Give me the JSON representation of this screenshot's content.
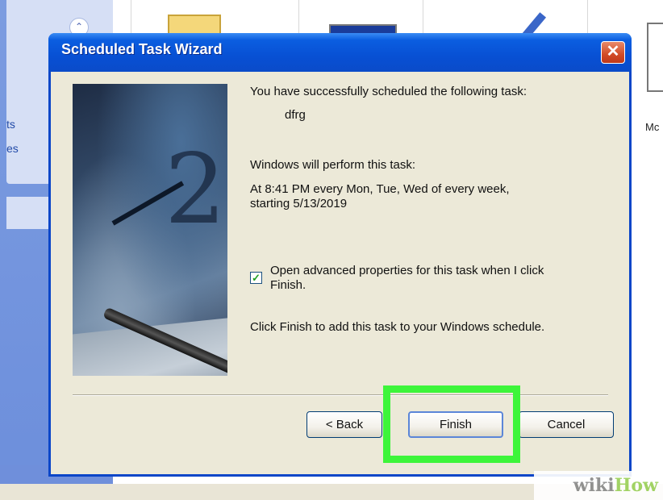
{
  "dialog": {
    "title": "Scheduled Task Wizard",
    "close_glyph": "✕",
    "success_text": "You have successfully scheduled the following task:",
    "task_name": "dfrg",
    "perform_label": "Windows will perform this task:",
    "schedule_line1": "At 8:41 PM every Mon, Tue, Wed of every week,",
    "schedule_line2": "starting 5/13/2019",
    "checkbox_line1": "Open advanced properties for this task when I click",
    "checkbox_line2": "Finish.",
    "checkbox_checked": true,
    "checkbox_mark": "✓",
    "finish_hint": "Click Finish to add this task to your Windows schedule.",
    "buttons": {
      "back": "< Back",
      "finish": "Finish",
      "cancel": "Cancel"
    }
  },
  "background": {
    "left_links": [
      "ts",
      "es"
    ],
    "right_text": "Mc",
    "chevron_glyph": "⌃"
  },
  "watermark": {
    "part1": "wiki",
    "part2": "How"
  },
  "colors": {
    "titlebar": "#0850d4",
    "dialog_bg": "#ece9d8",
    "highlight": "#3df53a",
    "side_panel": "#6d8fdc"
  }
}
